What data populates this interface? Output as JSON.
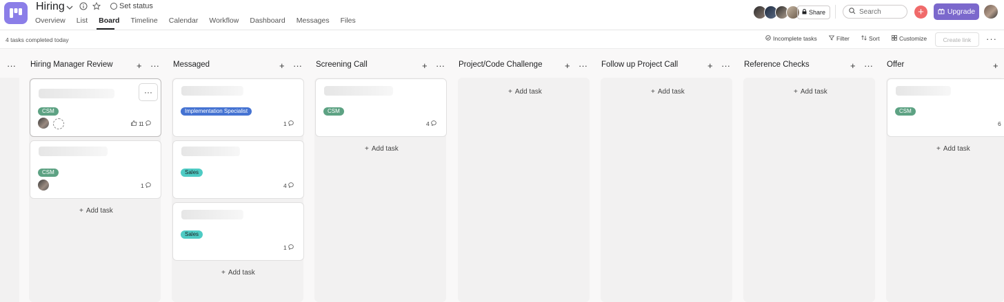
{
  "project": {
    "title": "Hiring",
    "set_status": "Set status"
  },
  "tabs": [
    "Overview",
    "List",
    "Board",
    "Timeline",
    "Calendar",
    "Workflow",
    "Dashboard",
    "Messages",
    "Files"
  ],
  "header": {
    "share": "Share",
    "search_placeholder": "Search",
    "upgrade": "Upgrade",
    "plus": "+"
  },
  "toolbar": {
    "completed": "4 tasks completed today",
    "incomplete": "Incomplete tasks",
    "filter": "Filter",
    "sort": "Sort",
    "customize": "Customize",
    "create_link": "Create link"
  },
  "add_task": "Add task",
  "columns": [
    {
      "name": "Hiring Manager Review"
    },
    {
      "name": "Messaged"
    },
    {
      "name": "Screening Call"
    },
    {
      "name": "Project/Code Challenge"
    },
    {
      "name": "Follow up Project Call"
    },
    {
      "name": "Reference Checks"
    },
    {
      "name": "Offer"
    }
  ],
  "cards": {
    "hmr1": {
      "tag": "CSM",
      "likes": "1",
      "comments": "1"
    },
    "hmr2": {
      "tag": "CSM",
      "comments": "1"
    },
    "msg1": {
      "tag": "Implementation Specialist",
      "comments": "1"
    },
    "msg2": {
      "tag": "Sales",
      "comments": "4"
    },
    "msg3": {
      "tag": "Sales",
      "comments": "1"
    },
    "scr1": {
      "tag": "CSM",
      "comments": "4"
    },
    "off1": {
      "tag": "CSM",
      "comments": "6"
    }
  },
  "colors": {
    "accent": "#7b68cc",
    "csm": "#5da283",
    "impl": "#4573d2",
    "sales": "#4ecbc4",
    "red": "#f06a6a"
  }
}
